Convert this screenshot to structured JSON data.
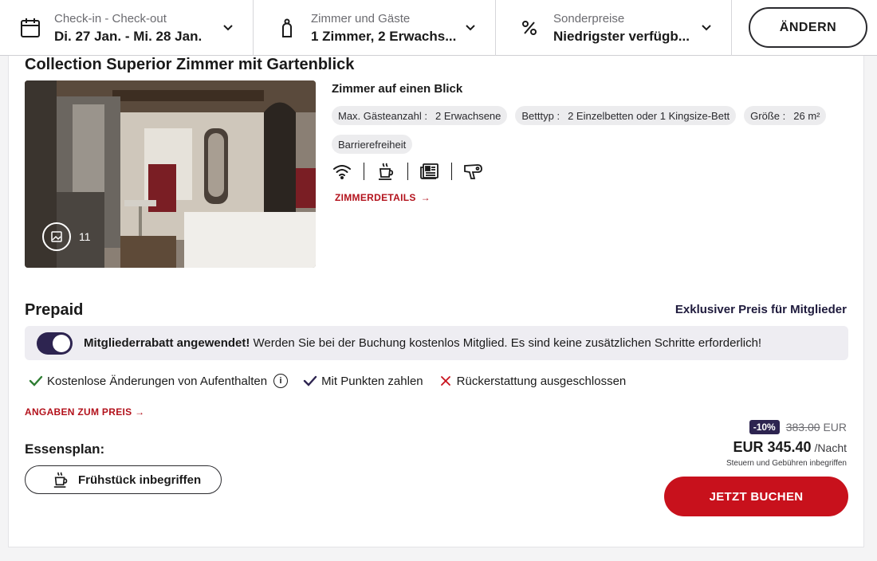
{
  "search_bar": {
    "dates": {
      "label": "Check-in - Check-out",
      "value": "Di. 27 Jan. - Mi. 28 Jan."
    },
    "rooms": {
      "label": "Zimmer und Gäste",
      "value": "1 Zimmer, 2 Erwachs..."
    },
    "rates": {
      "label": "Sonderpreise",
      "value": "Niedrigster verfügb..."
    },
    "change_button": "ÄNDERN"
  },
  "room": {
    "title": "Collection Superior Zimmer mit Gartenblick",
    "photo_count": "11",
    "glance_title": "Zimmer auf einen Blick",
    "chips": [
      {
        "label": "Max. Gästeanzahl :",
        "value": "2 Erwachsene"
      },
      {
        "label": "Betttyp :",
        "value": "2 Einzelbetten oder 1 Kingsize-Bett"
      },
      {
        "label": "Größe :",
        "value": "26 m²"
      },
      {
        "label": "",
        "value": "Barrierefreiheit"
      }
    ],
    "amenity_icons": [
      "wifi-icon",
      "coffee-icon",
      "newspaper-icon",
      "hairdryer-icon"
    ],
    "details_link": "ZIMMERDETAILS"
  },
  "rate": {
    "title": "Prepaid",
    "member_price": "Exklusiver Preis für Mitglieder",
    "banner_bold": "Mitgliederrabatt angewendet!",
    "banner_text": " Werden Sie bei der Buchung kostenlos Mitglied. Es sind keine zusätzlichen Schritte erforderlich!",
    "policies": [
      {
        "icon": "check-icon",
        "text": "Kostenlose Änderungen von Aufenthalten"
      },
      {
        "icon": "check-icon",
        "text": "Mit Punkten zahlen"
      },
      {
        "icon": "cross-icon",
        "text": "Rückerstattung ausgeschlossen"
      }
    ],
    "price_details_link": "ANGABEN ZUM PREIS",
    "meal_label": "Essensplan:",
    "meal_option": "Frühstück inbegriffen",
    "discount": "-10%",
    "original_price": "383.00",
    "original_currency": "EUR",
    "price": "EUR 345.40",
    "per_night": "/Nacht",
    "tax_note": "Steuern und Gebühren inbegriffen",
    "book_button": "JETZT BUCHEN"
  },
  "colors": {
    "accent_red": "#c8111c",
    "link_red": "#b3121c",
    "member_purple": "#2d2450",
    "check_green": "#2e7d32"
  }
}
